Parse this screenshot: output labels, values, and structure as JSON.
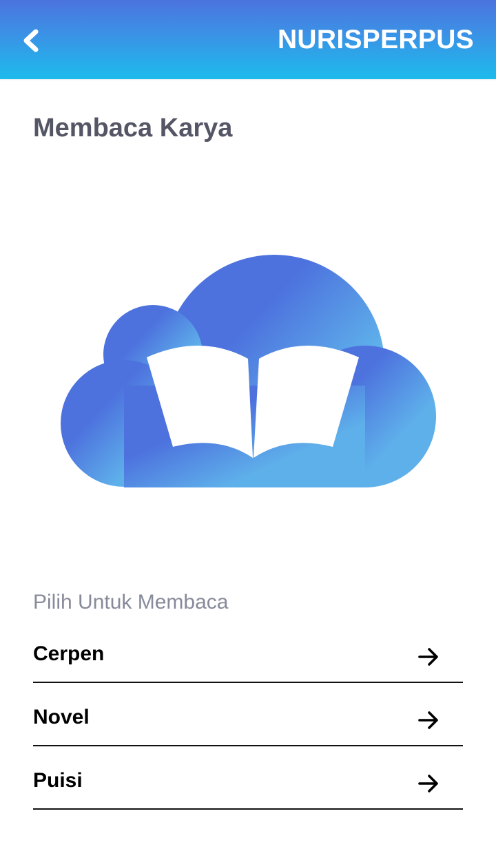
{
  "header": {
    "back_icon": "chevron-left-icon",
    "brand": "NURISPERPUS",
    "gradient": [
      "#4c73de",
      "#1dbbec"
    ]
  },
  "page": {
    "title": "Membaca Karya",
    "illustration": "cloud-book-icon",
    "illustration_colors": [
      "#4d72de",
      "#5eb0ea"
    ]
  },
  "menu": {
    "section_label": "Pilih Untuk Membaca",
    "items": [
      {
        "label": "Cerpen",
        "icon": "arrow-right-icon"
      },
      {
        "label": "Novel",
        "icon": "arrow-right-icon"
      },
      {
        "label": "Puisi",
        "icon": "arrow-right-icon"
      }
    ]
  }
}
